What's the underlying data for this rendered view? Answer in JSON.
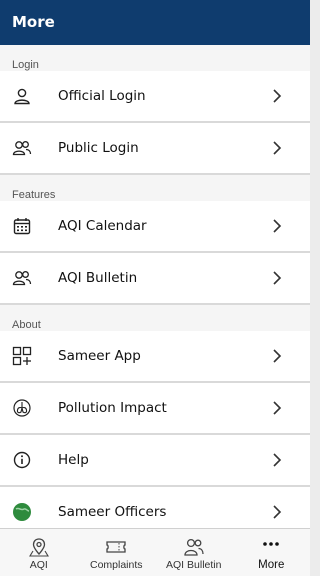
{
  "header": {
    "title": "More"
  },
  "sections": [
    {
      "label": "Login",
      "items": [
        {
          "label": "Official Login",
          "icon": "user-icon"
        },
        {
          "label": "Public Login",
          "icon": "users-icon"
        }
      ]
    },
    {
      "label": "Features",
      "items": [
        {
          "label": "AQI Calendar",
          "icon": "calendar-icon"
        },
        {
          "label": "AQI Bulletin",
          "icon": "users-icon"
        }
      ]
    },
    {
      "label": "About",
      "items": [
        {
          "label": "Sameer App",
          "icon": "grid-plus-icon"
        },
        {
          "label": "Pollution Impact",
          "icon": "lungs-icon"
        },
        {
          "label": "Help",
          "icon": "info-icon"
        },
        {
          "label": "Sameer Officers",
          "icon": "globe-icon"
        }
      ]
    }
  ],
  "tabs": [
    {
      "label": "AQI",
      "icon": "map-pin-icon"
    },
    {
      "label": "Complaints",
      "icon": "ticket-icon"
    },
    {
      "label": "AQI Bulletin",
      "icon": "users-icon"
    },
    {
      "label": "More",
      "icon": "more-dots-icon",
      "active": true
    }
  ],
  "colors": {
    "header_bg": "#0f3c6e",
    "accent_green": "#2e8b3d"
  }
}
